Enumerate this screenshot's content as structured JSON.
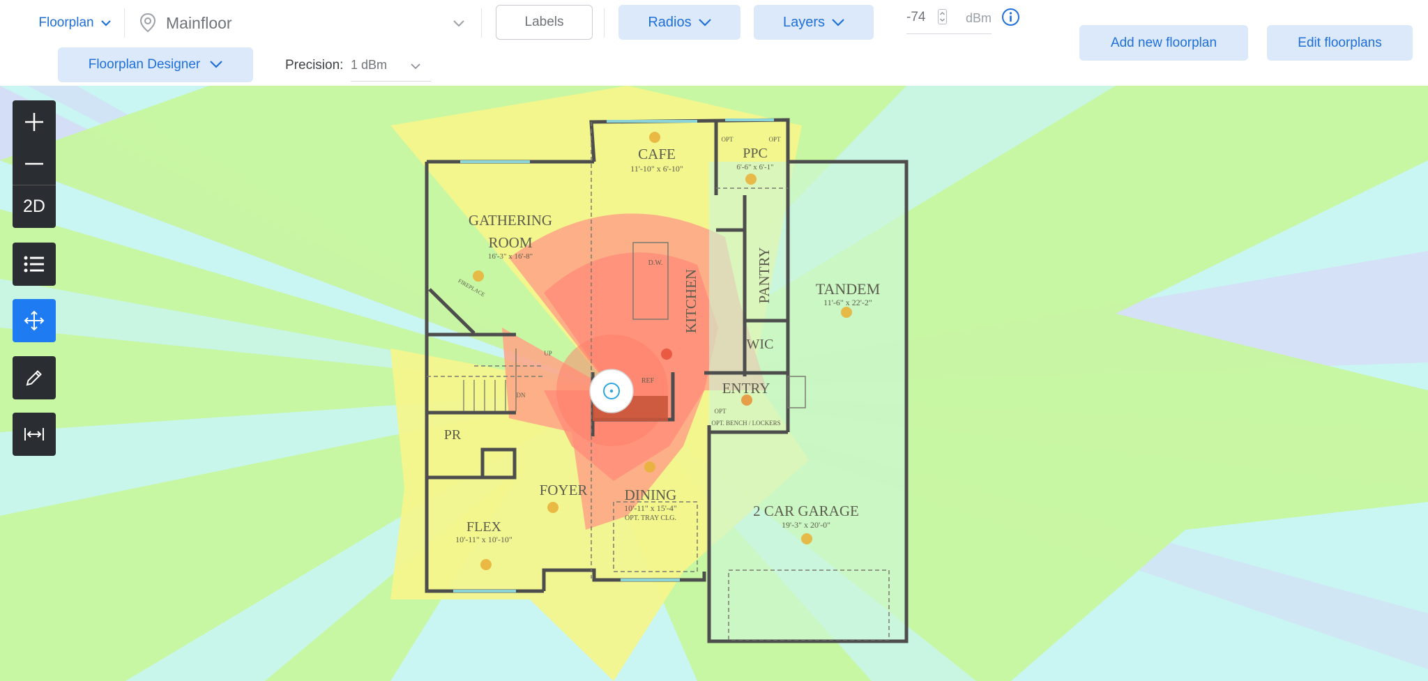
{
  "header": {
    "floorplan_menu": "Floorplan",
    "floor_select": "Mainfloor",
    "labels_button": "Labels",
    "radios_button": "Radios",
    "layers_button": "Layers",
    "threshold_value": "-74",
    "threshold_unit": "dBm",
    "add_button": "Add new floorplan",
    "edit_button": "Edit floorplans",
    "designer_button": "Floorplan Designer",
    "precision_label": "Precision:",
    "precision_value": "1 dBm"
  },
  "toolbar": {
    "view_mode": "2D"
  },
  "rooms": {
    "cafe": "CAFE",
    "cafe_dim": "11'-10\" x 6'-10\"",
    "ppc": "PPC",
    "ppc_dim": "6'-6\" x 6'-1\"",
    "opt_left": "OPT",
    "opt_right": "OPT",
    "gathering": "GATHERING",
    "room": "ROOM",
    "gathering_dim": "16'-3\" x 16'-8\"",
    "fireplace": "FIREPLACE",
    "kitchen": "KITCHEN",
    "dw": "D.W.",
    "pantry": "PANTRY",
    "tandem": "TANDEM",
    "tandem_dim": "11'-6\" x 22'-2\"",
    "wic": "WIC",
    "up": "UP",
    "dn": "DN",
    "ref": "REF",
    "entry": "ENTRY",
    "opt_entry": "OPT",
    "bench": "OPT. BENCH / LOCKERS",
    "pr": "PR",
    "foyer": "FOYER",
    "dining": "DINING",
    "dining_dim": "10'-11\" x 15'-4\"",
    "dining_opt": "OPT. TRAY CLG.",
    "flex": "FLEX",
    "flex_dim": "10'-11\" x 10'-10\"",
    "garage": "2 CAR GARAGE",
    "garage_dim": "19'-3\" x 20'-0\""
  },
  "colors": {
    "primary": "#1e6fd9",
    "button_bg": "#dbe9fb",
    "toolbar_bg": "#2a2e33",
    "tool_active": "#1e7bf2",
    "signal_strong": "#ff8c78",
    "signal_good": "#f5f58a",
    "signal_fair": "#c6f79a",
    "signal_weak": "#c9f5f2",
    "signal_none": "#d7d9f8"
  }
}
